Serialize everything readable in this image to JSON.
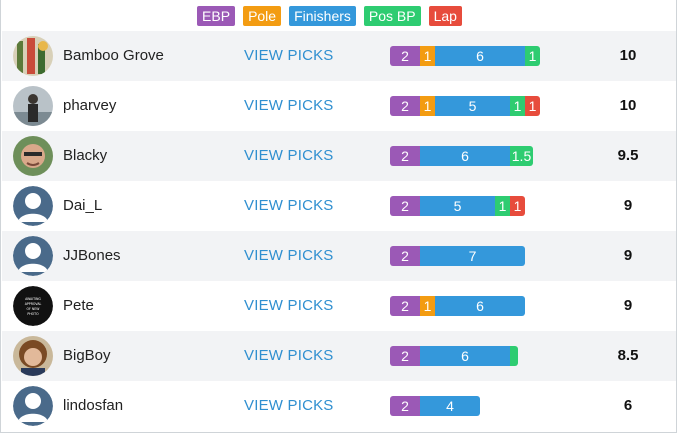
{
  "colors": {
    "ebp": "#9b59b6",
    "pole": "#f39c12",
    "finishers": "#3498db",
    "pos_bp": "#2ecc71",
    "lap": "#e74c3c",
    "link": "#2f8fd0"
  },
  "legend": [
    {
      "label": "EBP",
      "color": "#9b59b6"
    },
    {
      "label": "Pole",
      "color": "#f39c12"
    },
    {
      "label": "Finishers",
      "color": "#3498db"
    },
    {
      "label": "Pos BP",
      "color": "#2ecc71"
    },
    {
      "label": "Lap",
      "color": "#e74c3c"
    }
  ],
  "view_picks_label": "VIEW PICKS",
  "rows": [
    {
      "name": "Bamboo Grove",
      "avatar": "photo-bamboo",
      "score": "10",
      "segments": [
        {
          "type": "ebp",
          "value": 2,
          "label": "2"
        },
        {
          "type": "pole",
          "value": 1,
          "label": "1"
        },
        {
          "type": "finishers",
          "value": 6,
          "label": "6"
        },
        {
          "type": "pos_bp",
          "value": 1,
          "label": "1"
        }
      ]
    },
    {
      "name": "pharvey",
      "avatar": "photo-person",
      "score": "10",
      "segments": [
        {
          "type": "ebp",
          "value": 2,
          "label": "2"
        },
        {
          "type": "pole",
          "value": 1,
          "label": "1"
        },
        {
          "type": "finishers",
          "value": 5,
          "label": "5"
        },
        {
          "type": "pos_bp",
          "value": 1,
          "label": "1"
        },
        {
          "type": "lap",
          "value": 1,
          "label": "1"
        }
      ]
    },
    {
      "name": "Blacky",
      "avatar": "photo-face",
      "score": "9.5",
      "segments": [
        {
          "type": "ebp",
          "value": 2,
          "label": "2"
        },
        {
          "type": "finishers",
          "value": 6,
          "label": "6"
        },
        {
          "type": "pos_bp",
          "value": 1.5,
          "label": "1.5"
        }
      ]
    },
    {
      "name": "Dai_L",
      "avatar": "default",
      "score": "9",
      "segments": [
        {
          "type": "ebp",
          "value": 2,
          "label": "2"
        },
        {
          "type": "finishers",
          "value": 5,
          "label": "5"
        },
        {
          "type": "pos_bp",
          "value": 1,
          "label": "1"
        },
        {
          "type": "lap",
          "value": 1,
          "label": "1"
        }
      ]
    },
    {
      "name": "JJBones",
      "avatar": "default",
      "score": "9",
      "segments": [
        {
          "type": "ebp",
          "value": 2,
          "label": "2"
        },
        {
          "type": "finishers",
          "value": 7,
          "label": "7"
        }
      ]
    },
    {
      "name": "Pete",
      "avatar": "awaiting",
      "avatar_text": "AWAITING APPROVAL OF NEW PHOTO",
      "score": "9",
      "segments": [
        {
          "type": "ebp",
          "value": 2,
          "label": "2"
        },
        {
          "type": "pole",
          "value": 1,
          "label": "1"
        },
        {
          "type": "finishers",
          "value": 6,
          "label": "6"
        }
      ]
    },
    {
      "name": "BigBoy",
      "avatar": "photo-hair",
      "score": "8.5",
      "segments": [
        {
          "type": "ebp",
          "value": 2,
          "label": "2"
        },
        {
          "type": "finishers",
          "value": 6,
          "label": "6"
        },
        {
          "type": "pos_bp",
          "value": 0.5,
          "label": ""
        }
      ]
    },
    {
      "name": "lindosfan",
      "avatar": "default",
      "score": "6",
      "segments": [
        {
          "type": "ebp",
          "value": 2,
          "label": "2"
        },
        {
          "type": "finishers",
          "value": 4,
          "label": "4"
        }
      ]
    }
  ]
}
